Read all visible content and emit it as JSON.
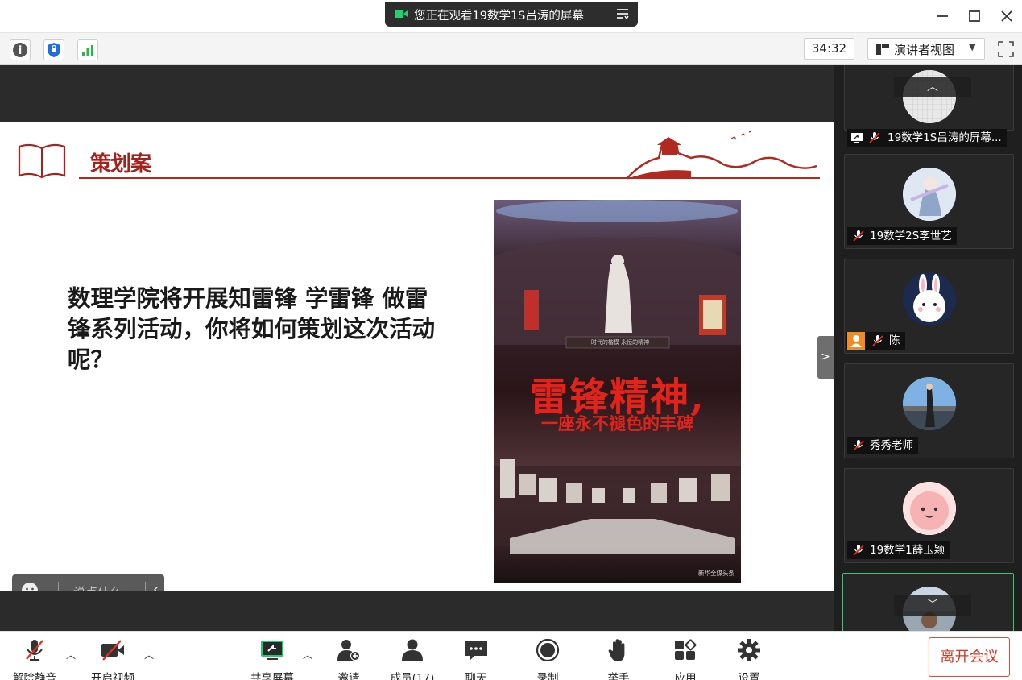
{
  "window": {
    "share_banner": "您正在观看19数学1S吕涛的屏幕",
    "minimize_icon": "minimize-icon",
    "maximize_icon": "maximize-icon",
    "close_icon": "close-icon"
  },
  "infobar": {
    "timer": "34:32",
    "view_mode": "演讲者视图",
    "icons": [
      "info-icon",
      "security-shield-icon",
      "signal-strength-icon"
    ]
  },
  "slide": {
    "title": "策划案",
    "question": "数理学院将开展知雷锋 学雷锋 做雷锋系列活动，你将如何策划这次活动呢？",
    "poster_heading": "雷锋精神,",
    "poster_sub": "一座永不褪色的丰碑",
    "poster_plaque": "时代的楷模  永恒的精神",
    "poster_credit": "新华全媒头条"
  },
  "chat_widget": {
    "placeholder": "说点什么..."
  },
  "participants": [
    {
      "name": "19数学1S吕涛的屏幕...",
      "type": "screen-share"
    },
    {
      "name": "19数学2S李世艺"
    },
    {
      "name": "陈"
    },
    {
      "name": "秀秀老师"
    },
    {
      "name": "19数学1薛玉颖"
    },
    {
      "name": ""
    }
  ],
  "controls": {
    "mute": "解除静音",
    "video": "开启视频",
    "share": "共享屏幕",
    "invite": "邀请",
    "members": "成员(17)",
    "chat": "聊天",
    "record": "录制",
    "raise_hand": "举手",
    "apps": "应用",
    "settings": "设置",
    "leave": "离开会议"
  },
  "colors": {
    "accent_red": "#e0321f",
    "slide_red": "#a8201a",
    "active_green": "#2ecc71",
    "share_green": "#28c76f"
  }
}
